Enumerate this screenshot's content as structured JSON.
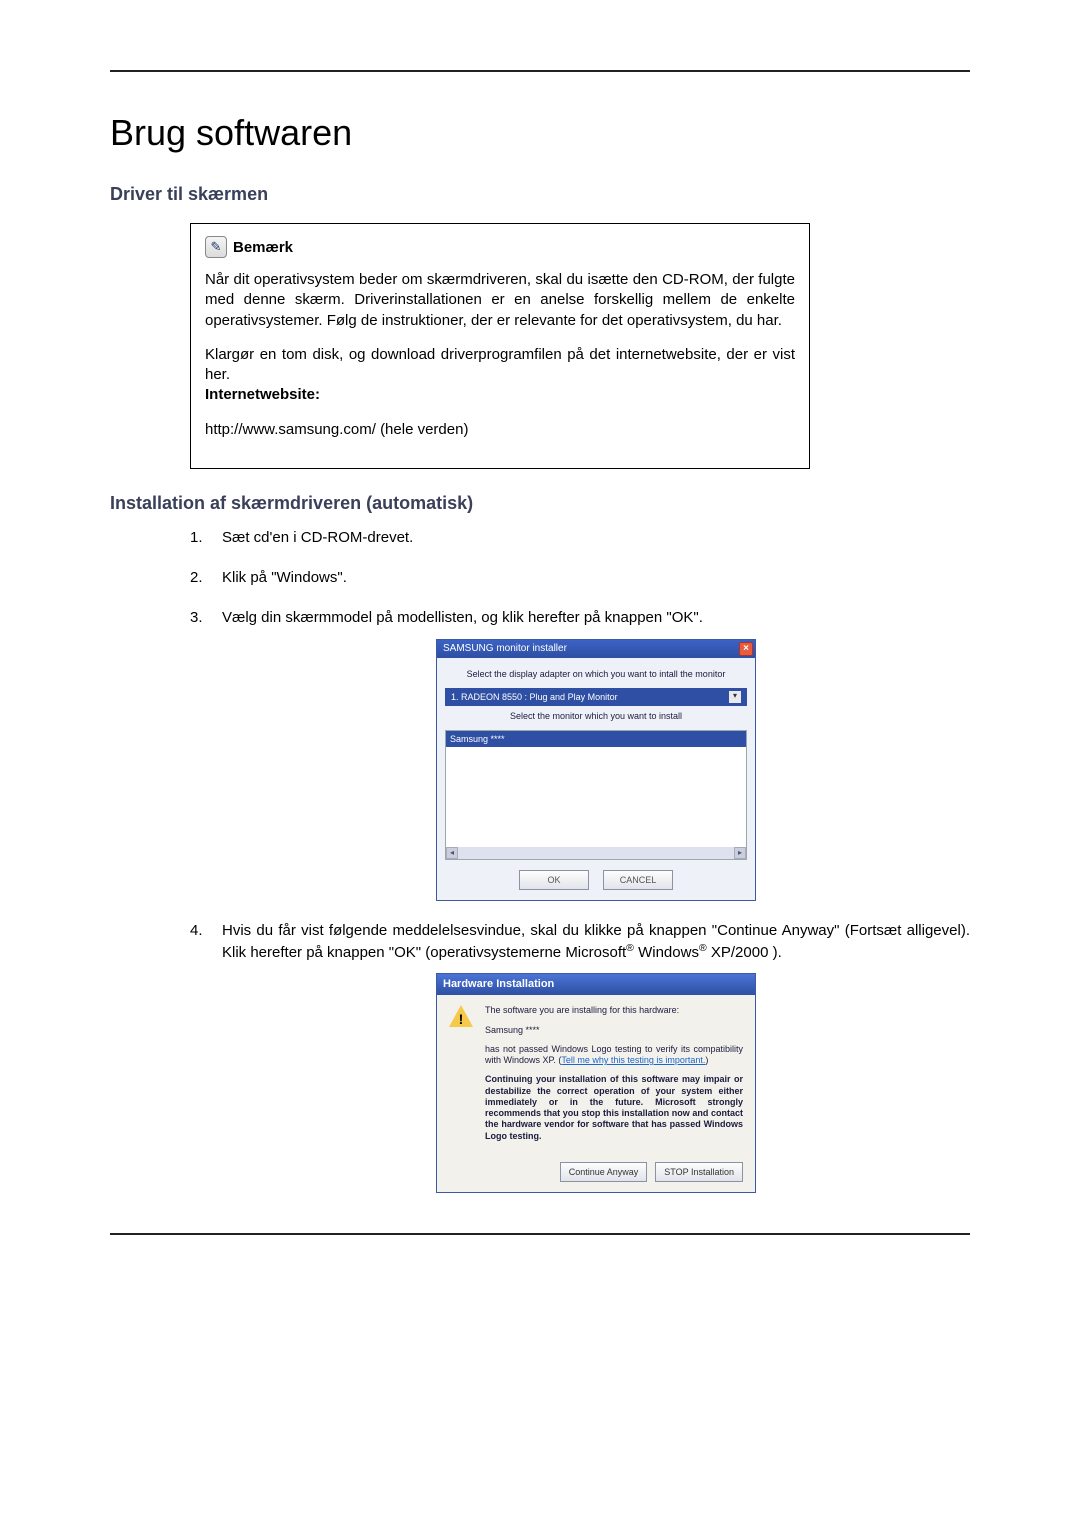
{
  "page_title": "Brug softwaren",
  "section_heading": "Driver til skærmen",
  "note": {
    "label": "Bemærk",
    "para1": "Når dit operativsystem beder om skærmdriveren, skal du isætte den CD-ROM, der fulgte med denne skærm. Driverinstallationen er en anelse forskellig mellem de enkelte operativsystemer. Følg de instruktioner, der er relevante for det operativsystem, du har.",
    "para2": "Klargør en tom disk, og download driverprogramfilen på det internetwebsite, der er vist her.",
    "website_label": "Internetwebsite:",
    "url": "http://www.samsung.com/ (hele verden)"
  },
  "sub_heading": "Installation af skærmdriveren (automatisk)",
  "steps": {
    "s1": "Sæt cd'en i CD-ROM-drevet.",
    "s2": "Klik på \"Windows\".",
    "s3": "Vælg din skærmmodel på modellisten, og klik herefter på knappen \"OK\".",
    "s4_a": "Hvis du får vist følgende meddelelsesvindue, skal du klikke på knappen \"Continue Anyway\" (Fortsæt alligevel). Klik herefter på knappen \"OK\" (operativsystemerne Microsoft",
    "s4_b": " Windows",
    "s4_c": " XP/2000 )."
  },
  "installer": {
    "title": "SAMSUNG monitor installer",
    "line1": "Select the display adapter on which you want to intall the monitor",
    "adapter": "1. RADEON 8550 : Plug and Play Monitor",
    "line2": "Select the monitor which you want to install",
    "selected": "Samsung ****",
    "ok": "OK",
    "cancel": "CANCEL"
  },
  "hw": {
    "title": "Hardware Installation",
    "p1": "The software you are installing for this hardware:",
    "p2": "Samsung ****",
    "p3a": "has not passed Windows Logo testing to verify its compatibility with Windows XP. (",
    "link": "Tell me why this testing is important.",
    "p3b": ")",
    "p4": "Continuing your installation of this software may impair or destabilize the correct operation of your system either immediately or in the future. Microsoft strongly recommends that you stop this installation now and contact the hardware vendor for software that has passed Windows Logo testing.",
    "btn_continue": "Continue Anyway",
    "btn_stop": "STOP Installation"
  }
}
